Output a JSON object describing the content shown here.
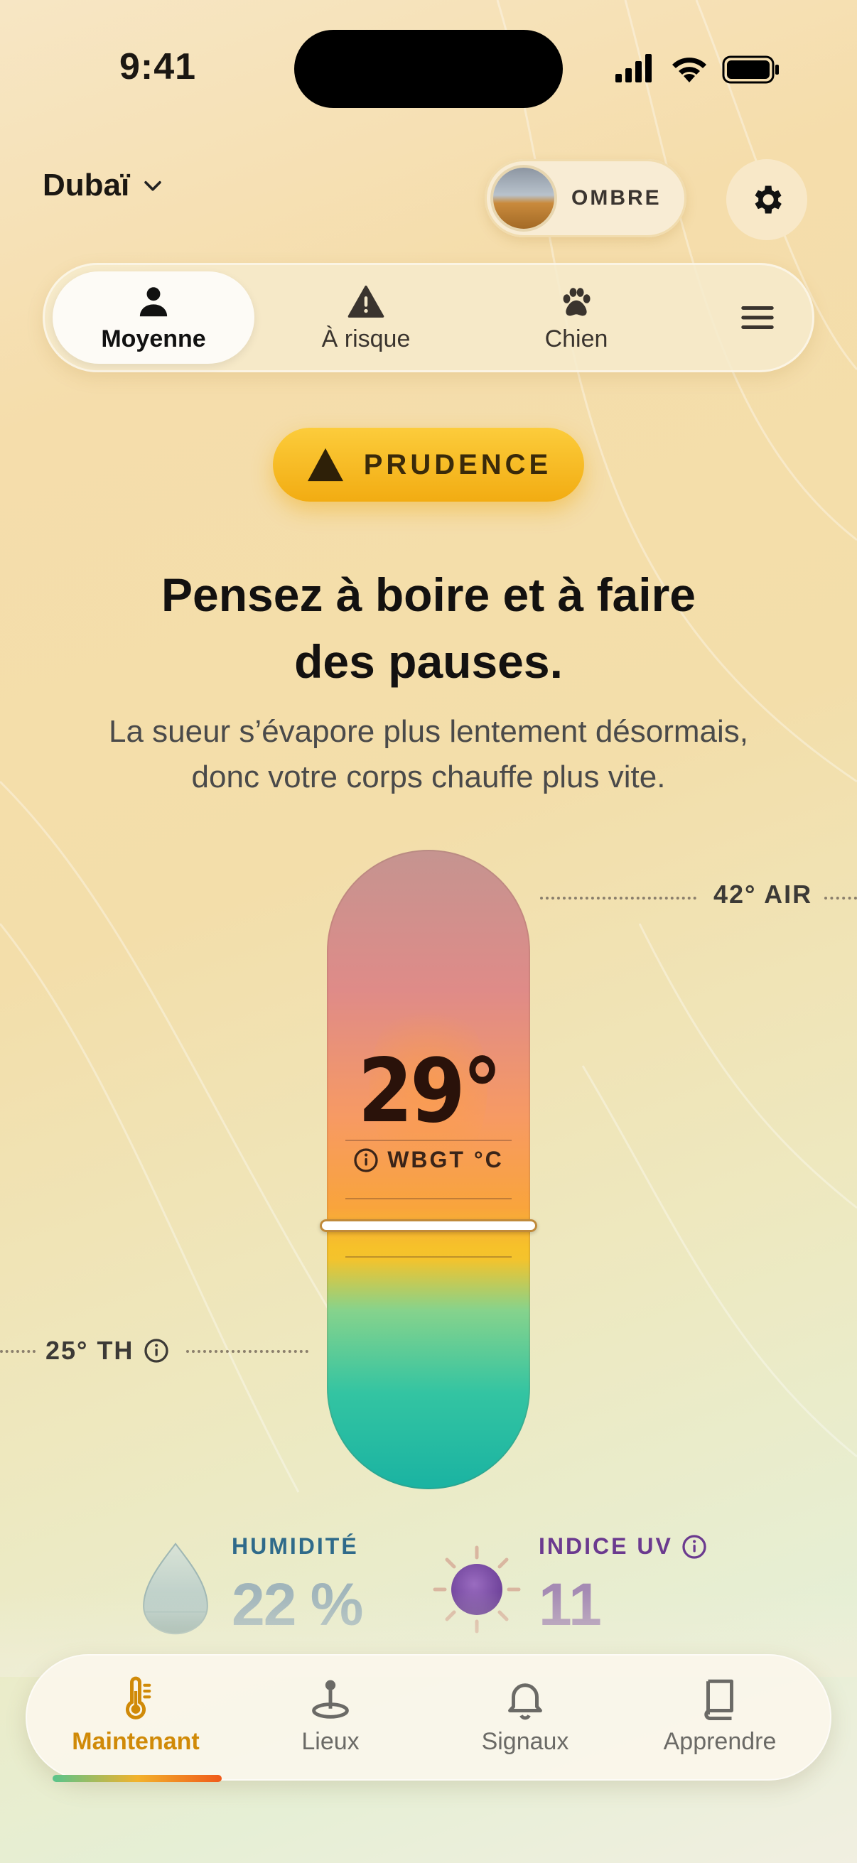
{
  "status_bar": {
    "time": "9:41"
  },
  "header": {
    "location": "Dubaï",
    "shade_toggle_label": "OMBRE"
  },
  "profile_tabs": [
    {
      "label": "Moyenne",
      "icon": "person-icon",
      "active": true
    },
    {
      "label": "À risque",
      "icon": "warning-triangle-icon",
      "active": false
    },
    {
      "label": "Chien",
      "icon": "paw-icon",
      "active": false
    }
  ],
  "alert": {
    "level": "PRUDENCE",
    "headline_line1": "Pensez à boire et à faire",
    "headline_line2": "des pauses.",
    "subtext_line1": "La sueur s’évapore plus lentement désormais,",
    "subtext_line2": "donc votre corps chauffe plus vite."
  },
  "gauge": {
    "wbgt_value": "29°",
    "wbgt_unit": "WBGT °C",
    "air_label": "42° AIR",
    "th_label": "25° TH"
  },
  "metrics": {
    "humidity": {
      "title": "HUMIDITÉ",
      "value": "22 %"
    },
    "uv": {
      "title": "INDICE UV",
      "value": "11"
    }
  },
  "bottom_nav": [
    {
      "label": "Maintenant",
      "icon": "thermometer-icon",
      "active": true
    },
    {
      "label": "Lieux",
      "icon": "map-pin-icon",
      "active": false
    },
    {
      "label": "Signaux",
      "icon": "bell-icon",
      "active": false
    },
    {
      "label": "Apprendre",
      "icon": "book-icon",
      "active": false
    }
  ],
  "colors": {
    "accent": "#d08a08",
    "alert_pill": "#f5b41c",
    "humidity_title": "#2f6a8a",
    "uv_title": "#6b3a8f"
  }
}
